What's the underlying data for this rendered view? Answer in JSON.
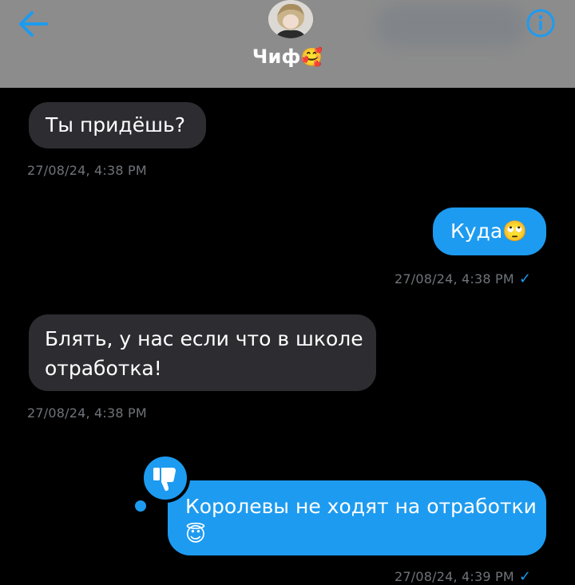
{
  "header": {
    "contact_name": "Чиф",
    "contact_emoji": "🥰",
    "back_icon": "arrow-left-icon",
    "info_icon": "info-circle-icon"
  },
  "messages": [
    {
      "direction": "incoming",
      "text": "Ты придёшь?",
      "timestamp": "27/08/24, 4:38 PM"
    },
    {
      "direction": "outgoing",
      "text": "Куда🙄",
      "timestamp": "27/08/24, 4:38 PM",
      "read": true
    },
    {
      "direction": "incoming",
      "text_line1": "Блять, у нас если что в школе",
      "text_line2": "отработка!",
      "timestamp": "27/08/24, 4:38 PM"
    },
    {
      "direction": "outgoing",
      "text_line1": "Королевы не ходят на отработки",
      "text_line2": "😇",
      "reaction_icon": "thumbs-down-icon",
      "timestamp": "27/08/24, 4:39 PM",
      "read": true
    }
  ],
  "colors": {
    "accent": "#1d9bf0",
    "incoming_bubble": "#2d2c31",
    "header_bg": "#8c8c8c",
    "timestamp": "#6f7479"
  }
}
